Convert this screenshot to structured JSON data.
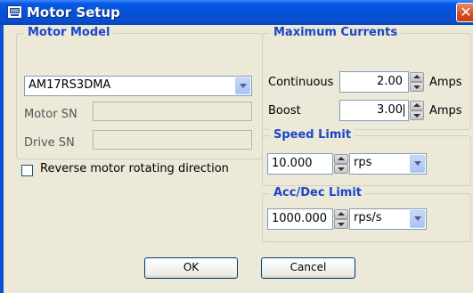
{
  "window": {
    "title": "Motor Setup",
    "icons": {
      "title": "motor-setup-window-icon",
      "close": "close-icon"
    },
    "close_glyph": "✕"
  },
  "motor_model": {
    "group_label": "Motor Model",
    "model_value": "AM17RS3DMA",
    "motor_sn_label": "Motor SN",
    "motor_sn_value": "",
    "drive_sn_label": "Drive SN",
    "drive_sn_value": ""
  },
  "reverse": {
    "label": "Reverse motor rotating direction",
    "checked": false
  },
  "max_currents": {
    "group_label": "Maximum Currents",
    "continuous_label": "Continuous",
    "continuous_value": "2.00",
    "boost_label": "Boost",
    "boost_value": "3.00",
    "unit": "Amps"
  },
  "speed_limit": {
    "group_label": "Speed Limit",
    "value": "10.000",
    "unit_selected": "rps"
  },
  "acc_dec_limit": {
    "group_label": "Acc/Dec Limit",
    "value": "1000.000",
    "unit_selected": "rps/s"
  },
  "buttons": {
    "ok": "OK",
    "cancel": "Cancel"
  },
  "colors": {
    "title_bar": "#0551d6",
    "dialog_bg": "#ece9d8",
    "group_label": "#1a47c8",
    "close_button": "#d4501f"
  }
}
